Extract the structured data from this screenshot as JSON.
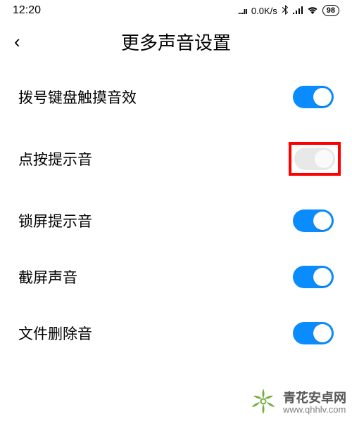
{
  "status_bar": {
    "time": "12:20",
    "signal_dots": "...ıı",
    "speed": "0.0K/s",
    "battery": "98"
  },
  "header": {
    "back_glyph": "‹",
    "title": "更多声音设置"
  },
  "settings": [
    {
      "label": "拨号键盘触摸音效",
      "on": true,
      "highlighted": false
    },
    {
      "label": "点按提示音",
      "on": false,
      "highlighted": true
    },
    {
      "label": "锁屏提示音",
      "on": true,
      "highlighted": false
    },
    {
      "label": "截屏声音",
      "on": true,
      "highlighted": false
    },
    {
      "label": "文件删除音",
      "on": true,
      "highlighted": false
    }
  ],
  "watermark": {
    "title": "青花安卓网",
    "url": "www.qhhlv.com",
    "logo_color": "#5aa01f"
  },
  "colors": {
    "toggle_on": "#0a8cff",
    "toggle_off": "#e8e8e8",
    "highlight": "#ff0000"
  }
}
